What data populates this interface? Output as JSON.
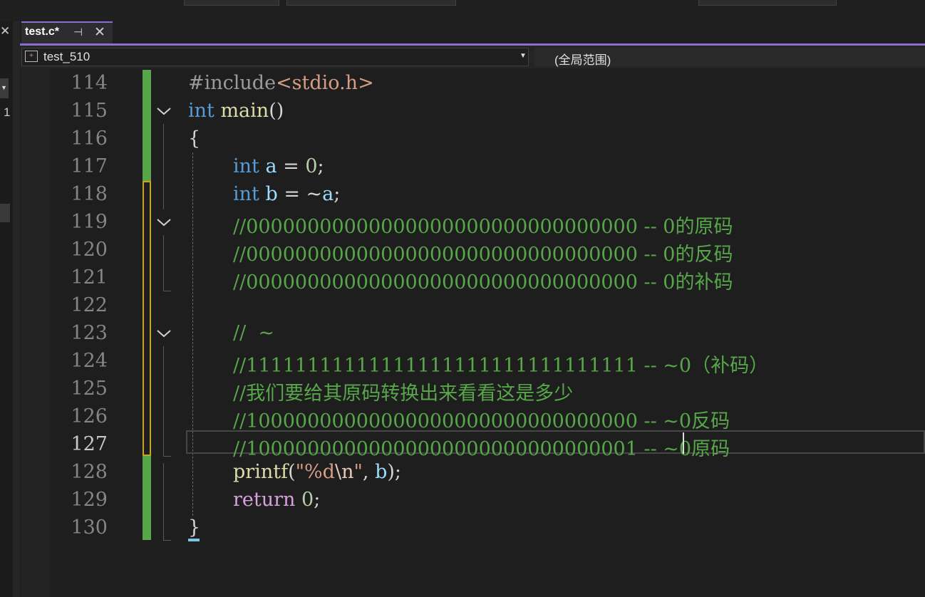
{
  "tab": {
    "title": "test.c*",
    "pin_glyph": "⊣",
    "close_glyph": "✕"
  },
  "navbar": {
    "project": "test_510",
    "scope": "(全局范围)"
  },
  "left_panel": {
    "close_glyph": "✕",
    "value": "1"
  },
  "editor": {
    "current_line": 127,
    "line_numbers": [
      "114",
      "115",
      "116",
      "117",
      "118",
      "119",
      "120",
      "121",
      "122",
      "123",
      "124",
      "125",
      "126",
      "127",
      "128",
      "129",
      "130"
    ],
    "lines": {
      "l114_directive": "#include",
      "l114_header": "<stdio.h>",
      "l115_type": "int",
      "l115_name": " main",
      "l115_parens": "()",
      "l116": "{",
      "l117_type": "int",
      "l117_var": " a",
      "l117_op": " = ",
      "l117_num": "0",
      "l117_end": ";",
      "l118_type": "int",
      "l118_var": " b",
      "l118_op": " = ~",
      "l118_var2": "a",
      "l118_end": ";",
      "l119": "//00000000000000000000000000000000 -- 0的原码",
      "l120": "//00000000000000000000000000000000 -- 0的反码",
      "l121": "//00000000000000000000000000000000 -- 0的补码",
      "l123": "//  ~",
      "l124": "//11111111111111111111111111111111 -- ~0（补码）",
      "l125": "//我们要给其原码转换出来看看这是多少",
      "l126": "//10000000000000000000000000000000 -- ~0反码",
      "l127": "//10000000000000000000000000000001 -- ~0原码",
      "l128_fn": "printf",
      "l128_open": "(",
      "l128_str1": "\"%d",
      "l128_esc": "\\n",
      "l128_str2": "\"",
      "l128_comma": ", ",
      "l128_var": "b",
      "l128_end": ");",
      "l129_kw": "return",
      "l129_sp": " ",
      "l129_num": "0",
      "l129_end": ";",
      "l130": "}"
    }
  },
  "colors": {
    "keyword": "#569cd6",
    "control_keyword": "#d8a0df",
    "function": "#dcdcaa",
    "variable": "#9cdcfe",
    "number": "#b5cea8",
    "string": "#d69d85",
    "comment": "#57a64a",
    "change_bar": "#57a64a",
    "unsaved_marker": "#c8a326",
    "tab_accent": "#8a6fd1"
  }
}
